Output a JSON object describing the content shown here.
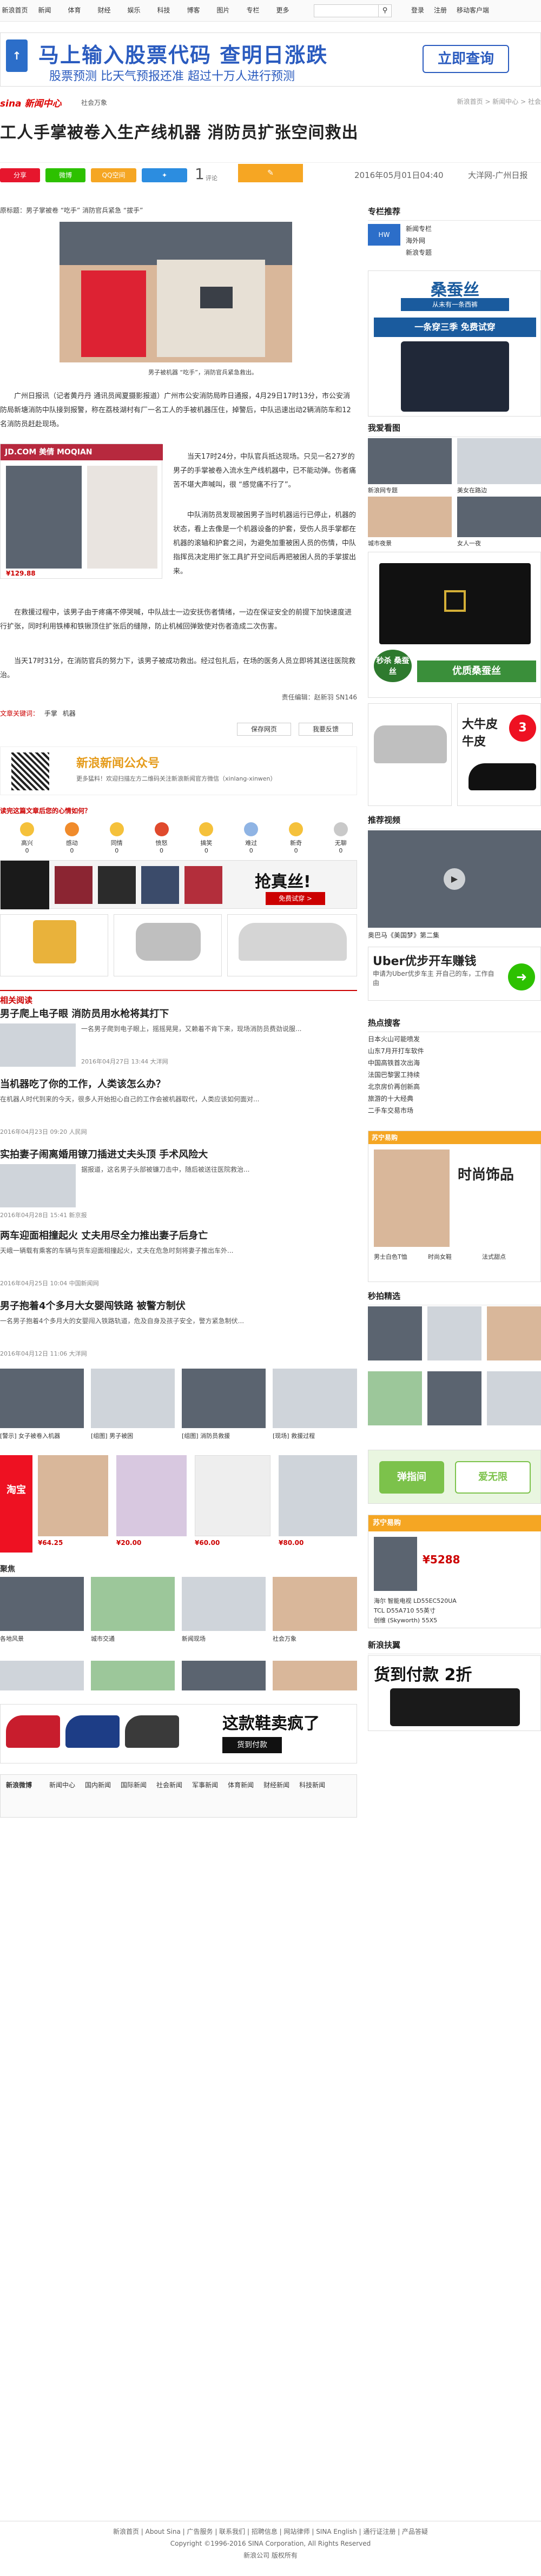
{
  "topnav": {
    "links": [
      "新浪首页",
      "新闻",
      "体育",
      "财经",
      "娱乐",
      "科技",
      "博客",
      "图片",
      "专栏",
      "更多"
    ],
    "search_placeholder": "",
    "right": [
      "登录",
      "注册",
      "移动客户端"
    ]
  },
  "topad": {
    "title": "马上输入股票代码  查明日涨跌",
    "subtitle": "股票预测 比天气预报还准 超过十万人进行预测",
    "button": "立即查询"
  },
  "sinanav": {
    "logo": "sina 新闻中心",
    "sub": "社会万象",
    "right": "新浪首页 > 新闻中心 > 社会"
  },
  "article": {
    "headline": "工人手掌被卷入生产线机器 消防员扩张空间救出",
    "share": [
      "分享",
      "微博",
      "QQ空间"
    ],
    "comments_count": "1",
    "comments_label": "评论",
    "date": "2016年05月01日04:40",
    "source": "大洋网-广州日报",
    "photo1_caption": "原标题：男子掌被卷 “吃手” 消防官兵紧急 “拔手”",
    "photo1_sub": "男子被机器 “吃手”，消防官兵紧急救出。",
    "para1": "广州日报讯（记者黄丹丹 通讯员闻夏摄影报道）广州市公安消防局昨日通报，4月29日17时13分，市公安消防局新塘消防中队接到报警，称在荔枝湖村有厂一名工人的手被机器压住，掉警后，中队迅速出动2辆消防车和12名消防员赶赴现场。",
    "para2": "当天17时24分，中队官兵抵达现场。只见一名27岁的男子的手掌被卷入流水生产线机器中，已不能动弹。伤者痛苦不堪大声喊叫，很 “感觉痛不行了”。",
    "para3": "中队消防员发现被困男子当时机器运行已停止，机器的状态，看上去像是一个机器设备的护套，受伤人员手掌都在机器的滚轴和护套之间，为避免加重被困人员的伤情，中队指挥员决定用扩张工具扩开空间后再把被困人员的手掌拔出来。",
    "para4": "在救援过程中，该男子由于疼痛不停哭喊，中队战士一边安抚伤者情绪，一边在保证安全的前提下加快速度进行扩张，同时利用铁棒和铁锹顶住扩张后的缝隙，防止机械回弹致使对伤者造成二次伤害。",
    "para5": "当天17时31分，在消防官兵的努力下，该男子被成功救出。经过包扎后，在场的医务人员立即将其送往医院救治。",
    "editor": "责任编辑：赵新羽 SN146",
    "tags_label": "文章关键词：",
    "tags": [
      "手掌",
      "机器"
    ],
    "actions": [
      "保存网页",
      "我要反馈"
    ]
  },
  "qrcode": {
    "title": "新浪新闻公众号",
    "desc": "更多猛料！欢迎扫描左方二维码关注新浪新闻官方微信（xinlang-xinwen）"
  },
  "mood": {
    "title": "读完这篇文章后您的心情如何？",
    "items": [
      "高兴",
      "感动",
      "同情",
      "愤怒",
      "搞笑",
      "难过",
      "新奇",
      "无聊"
    ],
    "counts": [
      "0",
      "0",
      "0",
      "0",
      "0",
      "0",
      "0",
      "0"
    ]
  },
  "related": {
    "title": "相关阅读",
    "items": [
      {
        "title": "男子爬上电子眼 消防员用水枪将其打下",
        "meta": "2016年04月27日 13:44  大洋网",
        "body": "一名男子爬到电子眼上，摇摇晃晃，又赖着不肯下来，现场消防员费劲说服..."
      },
      {
        "title": "当机器吃了你的工作，人类该怎么办？",
        "meta": "2016年04月23日 09:20  人民网",
        "body": "在机器人时代到来的今天，很多人开始担心自己的工作会被机器取代，人类应该如何面对..."
      },
      {
        "title": "实拍妻子闹离婚用镣刀插进丈夫头顶 手术风险大",
        "meta": "2016年04月28日 15:41  新京报",
        "body": "据报道，这名男子头部被镰刀击中，随后被送往医院救治..."
      },
      {
        "title": "两车迎面相撞起火 丈夫用尽全力推出妻子后身亡",
        "meta": "2016年04月25日 10:04  中国新闻网",
        "body": "天峨一辆载有乘客的车辆与货车迎面相撞起火，丈夫在危急时刻将妻子推出车外..."
      },
      {
        "title": "男子抱着4个多月大女婴闯铁路 被警方制伏",
        "meta": "2016年04月12日 11:06  大洋网",
        "body": "一名男子抱着4个多月大的女婴闯入铁路轨道，危及自身及孩子安全，警方紧急制伏..."
      }
    ]
  },
  "photostrip": {
    "captions": [
      "[警示] 女子被卷入机器",
      "[组图] 男子被困",
      "[组图] 消防员救援",
      "[现场] 救援过程"
    ]
  },
  "shop_row": {
    "prices": [
      "¥64.25",
      "¥20.00",
      "¥60.00",
      "¥80.00"
    ]
  },
  "gallery": {
    "title": "聚焦",
    "captions": [
      "各地风景",
      "城市交通",
      "新闻现场",
      "社会万象"
    ]
  },
  "bottom_nav": {
    "label": "新浪微博",
    "links": [
      "新闻中心",
      "国内新闻",
      "国际新闻",
      "社会新闻",
      "军事新闻",
      "体育新闻",
      "财经新闻",
      "科技新闻"
    ]
  },
  "sidebar": {
    "ad1_title": "专栏推荐",
    "ad1_items": [
      "新闻专栏",
      "海外网",
      "新浪专题"
    ],
    "ad2_banner": "桑蚕丝",
    "ad2_sub": "从未有一条西裤",
    "ad2_btn": "一条穿三季 免费试穿",
    "grid_title": "我爱看图",
    "grid_captions": [
      "新浪网专题",
      "美女在路边",
      "城市夜景",
      "女人一夜"
    ],
    "pants_text": "秒杀 桑蚕丝",
    "pants_btn": "优质桑蚕丝",
    "video_title": "推荐视频",
    "video_caption": "奥巴马《美国梦》第二集",
    "uber_title": "Uber优步开车赚钱",
    "uber_sub": "申请为Uber优步车主 开自己的车，工作自由",
    "hot_title": "热点搜客",
    "hot_items": [
      "日本火山可能喷发",
      "山东7月开打车软件",
      "中国高铁首次出海",
      "法国巴黎罢工持续",
      "北京房价再创新高",
      "旅游的十大经典",
      "二手车交易市场"
    ],
    "shop_title": "苏宁易购",
    "shop_items": [
      "男士白色T恤",
      "时尚女鞋",
      "法式甜点"
    ],
    "discover_title": "秒拍精选",
    "phone_ad": "苏宁易购",
    "phone_price": "¥5288",
    "phone_items": [
      "海尔 智能电视 LD55EC520UA",
      "TCL D55A710 55英寸",
      "创维 (Skyworth) 55X5"
    ],
    "final_title": "新浪扶翼",
    "final_ad": "货到付款 2折"
  },
  "footer": {
    "line1": "新浪首页 | About Sina | 广告服务 | 联系我们 | 招聘信息 | 网站律师 | SINA English | 通行证注册 | 产品答疑",
    "line2": "Copyright ©1996-2016 SINA Corporation, All Rights Reserved",
    "line3": "新浪公司 版权所有"
  },
  "colors": {
    "brand_red": "#d00000",
    "accent_blue": "#2a5bbf",
    "weibo_red": "#e6162d",
    "wechat_green": "#2dc100",
    "qq_yellow": "#f5a623"
  }
}
